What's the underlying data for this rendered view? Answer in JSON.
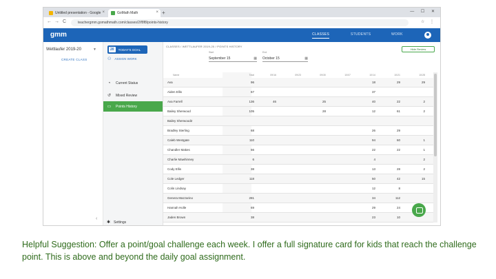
{
  "browser": {
    "tabs": [
      {
        "title": "Untitled presentation - Google",
        "favicon_color": "#f4b400"
      },
      {
        "title": "GoMath Math",
        "favicon_color": "#49a84b"
      }
    ],
    "new_tab": "+",
    "window_controls": "— ☐ ✕",
    "url": "teachergmm.gomathmath.com/classes/2/f8f8/points-history",
    "back": "←",
    "forward": "→",
    "reload": "C"
  },
  "app": {
    "logo": "gmm",
    "nav": [
      {
        "label": "CLASSES",
        "active": true
      },
      {
        "label": "STUDENTS",
        "active": false
      },
      {
        "label": "WORK",
        "active": false
      }
    ]
  },
  "sidebar": {
    "class_name": "Wettlaufer 2019-20",
    "caret": "▼",
    "create_class": "CREATE CLASS",
    "collapse": "‹"
  },
  "menu": {
    "goal_num": "20",
    "goal_label": "TODAY'S GOAL",
    "assign_label": "ASSIGN WORK",
    "items": [
      {
        "label": "Current Status",
        "icon": "dashboard-icon",
        "glyph": "◔",
        "active": false
      },
      {
        "label": "Mixed Review",
        "icon": "history-icon",
        "glyph": "↺",
        "active": false
      },
      {
        "label": "Points History",
        "icon": "calendar-icon",
        "glyph": "▭",
        "active": true
      }
    ],
    "settings": "Settings",
    "settings_glyph": "✱"
  },
  "main": {
    "breadcrumb": "CLASSES  /  WETTLAUFER 2019-20  /  POINTS HISTORY",
    "hide_button": "Hide Review",
    "start_label": "Start",
    "start_value": "September 15",
    "end_label": "End",
    "end_value": "October 15",
    "headers": [
      "Name",
      "Total",
      "09/16",
      "09/23",
      "09/30",
      "10/07",
      "10/14",
      "10/21",
      "10/28"
    ],
    "rows": [
      {
        "name": "Ava",
        "total": "96",
        "c": [
          "",
          "",
          "",
          "",
          "18",
          "29",
          "29"
        ]
      },
      {
        "name": "Aiden Ellis",
        "total": "67",
        "c": [
          "",
          "",
          "",
          "",
          "37",
          "",
          ""
        ]
      },
      {
        "name": "Ava Farrell",
        "total": "136",
        "c": [
          "46",
          "",
          "25",
          "",
          "40",
          "22",
          "2"
        ]
      },
      {
        "name": "Bailey Sherwood",
        "total": "105",
        "c": [
          "",
          "",
          "28",
          "",
          "12",
          "61",
          "2"
        ]
      },
      {
        "name": "Bailey Sherwood2",
        "total": "",
        "c": [
          "",
          "",
          "",
          "",
          "",
          "",
          ""
        ]
      },
      {
        "name": "Bradley Sterling",
        "total": "68",
        "c": [
          "",
          "",
          "",
          "",
          "26",
          "29",
          ""
        ]
      },
      {
        "name": "Caleb Westgate",
        "total": "110",
        "c": [
          "",
          "",
          "",
          "",
          "94",
          "60",
          "1"
        ]
      },
      {
        "name": "Chandler Makes",
        "total": "56",
        "c": [
          "",
          "",
          "",
          "",
          "22",
          "22",
          "1"
        ]
      },
      {
        "name": "Charlie Mawhinney",
        "total": "6",
        "c": [
          "",
          "",
          "",
          "",
          "4",
          "",
          "2"
        ]
      },
      {
        "name": "Cody Ellis",
        "total": "38",
        "c": [
          "",
          "",
          "",
          "",
          "13",
          "28",
          "2"
        ]
      },
      {
        "name": "Cole Ledger",
        "total": "118",
        "c": [
          "",
          "",
          "",
          "",
          "50",
          "42",
          "15"
        ]
      },
      {
        "name": "Colin Lindsay",
        "total": "",
        "c": [
          "",
          "",
          "",
          "",
          "12",
          "8",
          ""
        ]
      },
      {
        "name": "Genera Mazzarino",
        "total": "281",
        "c": [
          "",
          "",
          "",
          "",
          "34",
          "112",
          ""
        ]
      },
      {
        "name": "Hannah Holle",
        "total": "69",
        "c": [
          "",
          "",
          "",
          "",
          "29",
          "24",
          ""
        ]
      },
      {
        "name": "Jaden Brown",
        "total": "38",
        "c": [
          "",
          "",
          "",
          "",
          "23",
          "10",
          ""
        ]
      }
    ]
  },
  "caption": "Helpful Suggestion:  Offer a point/goal challenge each week.  I offer a full signature card for kids that reach the challenge point.  This is above and beyond the daily goal assignment."
}
